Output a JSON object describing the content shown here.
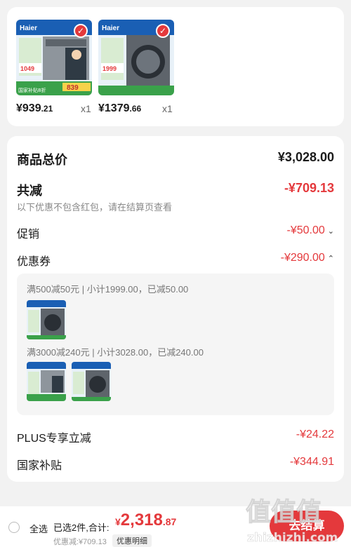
{
  "products": [
    {
      "price_int": "¥939",
      "price_dec": ".21",
      "qty": "x1",
      "brand": "Haier",
      "badge_price": "1049",
      "promo_price": "839",
      "promo_tag": "国家补贴8折"
    },
    {
      "price_int": "¥1379",
      "price_dec": ".66",
      "qty": "x1",
      "brand": "Haier",
      "badge_price": "1999"
    }
  ],
  "summary": {
    "total_label": "商品总价",
    "total_value": "¥3,028.00",
    "reduce_label": "共减",
    "reduce_value": "-¥709.13",
    "reduce_note": "以下优惠不包含红包，请在结算页查看",
    "promo_label": "促销",
    "promo_value": "-¥50.00",
    "coupon_label": "优惠券",
    "coupon_value": "-¥290.00",
    "coupons": [
      {
        "title": "满500减50元 | 小计1999.00，已减50.00"
      },
      {
        "title": "满3000减240元 | 小计3028.00，已减240.00"
      }
    ],
    "plus_label": "PLUS专享立减",
    "plus_value": "-¥24.22",
    "subsidy_label": "国家补贴",
    "subsidy_value": "-¥344.91"
  },
  "bottom": {
    "select_all": "全选",
    "selected_info": "已选2件,合计:",
    "currency": "¥",
    "total_int": "2,318",
    "total_dec": ".87",
    "discount_text": "优惠减:¥709.13",
    "detail_btn": "优惠明细",
    "pay_btn": "去结算"
  },
  "watermark": {
    "text": "值 值 值",
    "domain": "zhizhizhi.com"
  },
  "colors": {
    "accent": "#e4393c",
    "page_bg": "#f2f2f2"
  }
}
